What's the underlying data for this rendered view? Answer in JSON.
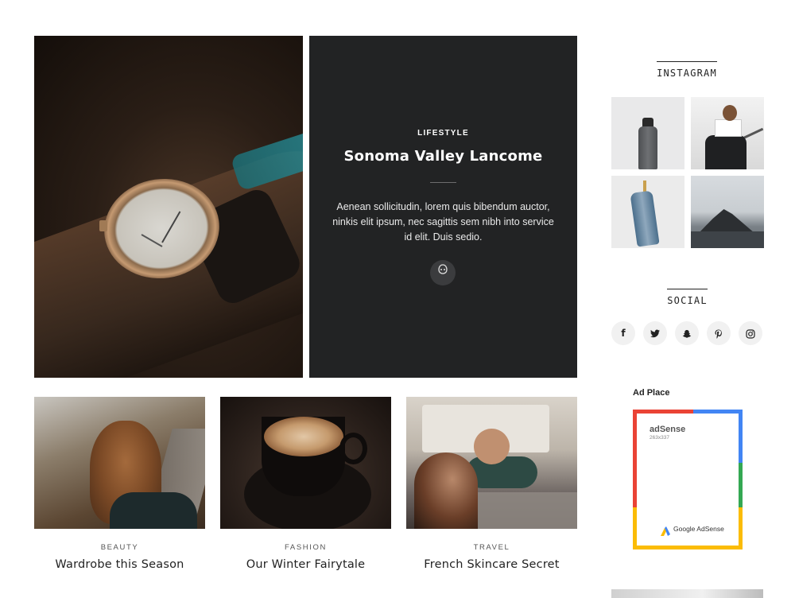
{
  "featured": {
    "category": "LIFESTYLE",
    "title": "Sonoma Valley Lancome",
    "excerpt": "Aenean sollicitudin, lorem quis bibendum auctor, ninkis elit ipsum, nec sagittis sem nibh into service id elit. Duis sedio.",
    "more_icon": "alien-icon"
  },
  "posts": [
    {
      "category": "BEAUTY",
      "title": "Wardrobe this Season"
    },
    {
      "category": "FASHION",
      "title": "Our Winter Fairytale"
    },
    {
      "category": "TRAVEL",
      "title": "French Skincare Secret"
    }
  ],
  "sidebar": {
    "instagram": {
      "title": "INSTAGRAM",
      "images": [
        "bottle",
        "woman-on-railing",
        "hanging-jeans",
        "sea-rock"
      ]
    },
    "social": {
      "title": "SOCIAL",
      "icons": [
        {
          "name": "facebook-icon",
          "glyph": "f"
        },
        {
          "name": "twitter-icon",
          "glyph": "🐦"
        },
        {
          "name": "snapchat-icon",
          "glyph": "👻"
        },
        {
          "name": "pinterest-icon",
          "glyph": "p"
        },
        {
          "name": "instagram-icon",
          "glyph": "◎"
        }
      ]
    },
    "ad": {
      "heading": "Ad Place",
      "brand": "adSense",
      "size": "263x337",
      "footer": "Google AdSense",
      "colors": {
        "red": "#ea4335",
        "blue": "#4285f4",
        "green": "#34a853",
        "yellow": "#fbbc05"
      }
    }
  }
}
